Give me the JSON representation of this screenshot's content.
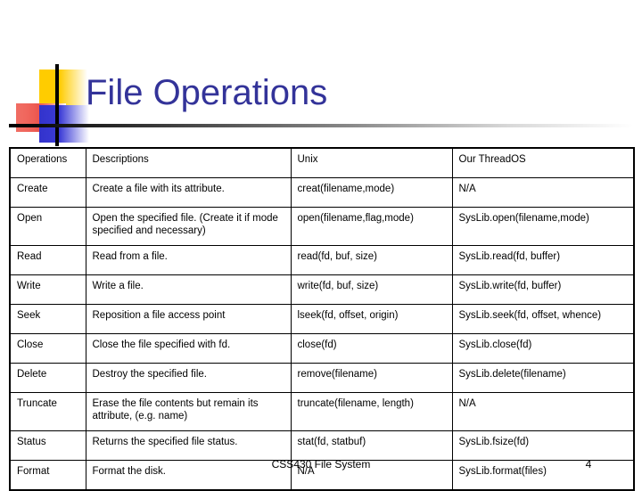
{
  "slide": {
    "title": "File Operations",
    "title_color": "#333399",
    "background": "#ffffff"
  },
  "logo": {
    "yellow": "#FFCC00",
    "red": "#E8403A",
    "blue": "#3333CC",
    "crosshair": "#000000"
  },
  "table": {
    "headers": [
      "Operations",
      "Descriptions",
      "Unix",
      "Our ThreadOS"
    ],
    "rows": [
      {
        "operation": "Create",
        "description": "Create a file with its attribute.",
        "unix": "creat(filename,mode)",
        "threados": "N/A"
      },
      {
        "operation": "Open",
        "description": "Open the specified file. (Create it if mode specified and necessary)",
        "unix": "open(filename,flag,mode)",
        "threados": "SysLib.open(filename,mode)"
      },
      {
        "operation": "Read",
        "description": "Read from a file.",
        "unix": "read(fd, buf, size)",
        "threados": "SysLib.read(fd, buffer)"
      },
      {
        "operation": "Write",
        "description": "Write a file.",
        "unix": "write(fd, buf, size)",
        "threados": "SysLib.write(fd, buffer)"
      },
      {
        "operation": "Seek",
        "description": "Reposition a file access point",
        "unix": "lseek(fd, offset, origin)",
        "threados": "SysLib.seek(fd, offset, whence)"
      },
      {
        "operation": "Close",
        "description": "Close the file specified with fd.",
        "unix": "close(fd)",
        "threados": "SysLib.close(fd)"
      },
      {
        "operation": "Delete",
        "description": "Destroy the specified file.",
        "unix": "remove(filename)",
        "threados": "SysLib.delete(filename)"
      },
      {
        "operation": "Truncate",
        "description": "Erase the file contents but remain its attribute, (e.g. name)",
        "unix": "truncate(filename, length)",
        "threados": "N/A"
      },
      {
        "operation": "Status",
        "description": "Returns the specified file status.",
        "unix": "stat(fd, statbuf)",
        "threados": "SysLib.fsize(fd)"
      },
      {
        "operation": "Format",
        "description": "Format the disk.",
        "unix": "N/A",
        "threados": "SysLib.format(files)"
      }
    ]
  },
  "footer": {
    "center_text": "CSS430 File System",
    "page_number": "4"
  }
}
